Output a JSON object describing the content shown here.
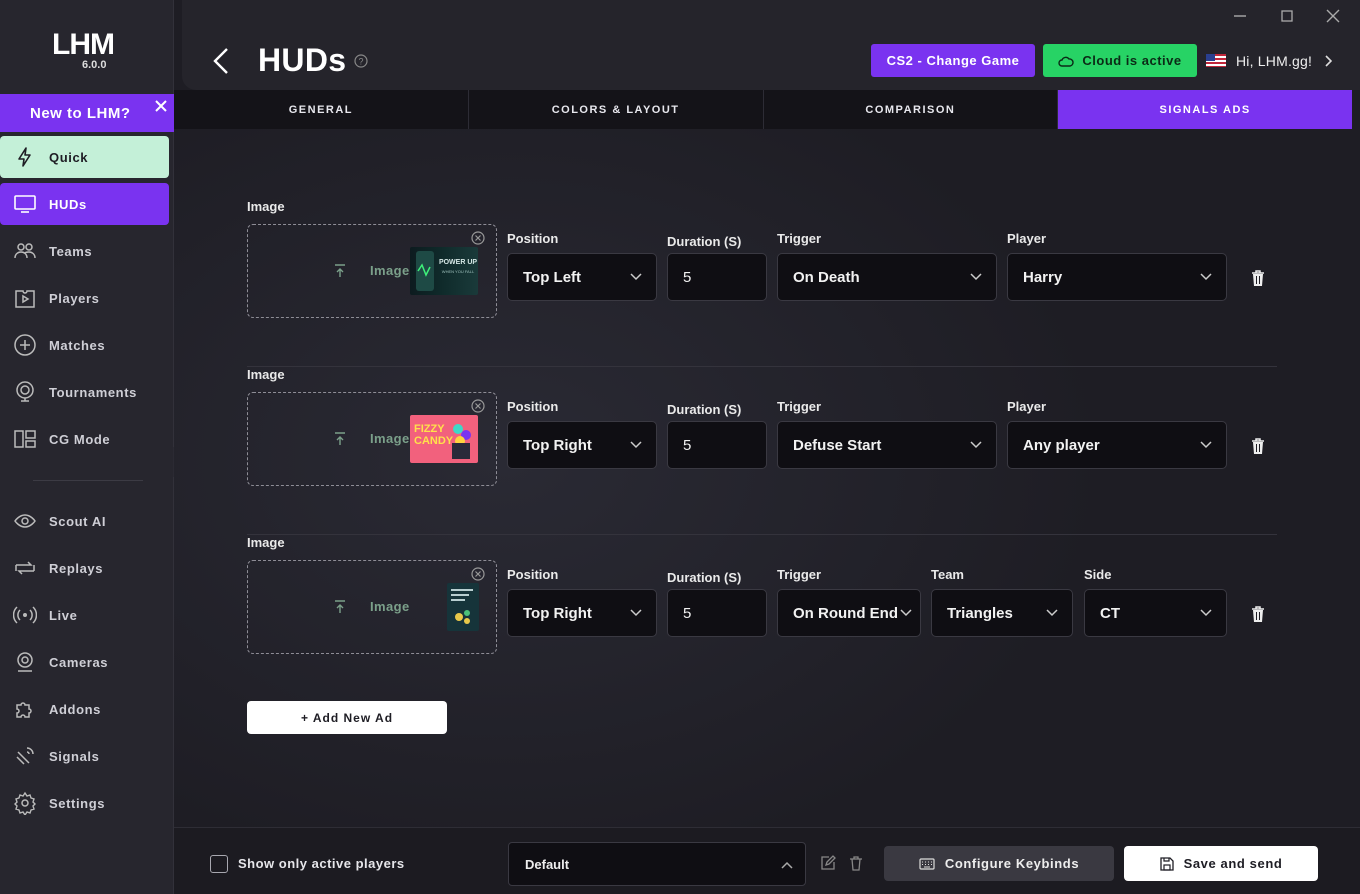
{
  "app": {
    "logo_text": "LHM",
    "version": "6.0.0"
  },
  "promo": {
    "label": "New to LHM?"
  },
  "sidebar": {
    "items": [
      {
        "label": "Quick",
        "icon": "lightning-icon"
      },
      {
        "label": "HUDs",
        "icon": "monitor-icon"
      },
      {
        "label": "Teams",
        "icon": "team-icon"
      },
      {
        "label": "Players",
        "icon": "player-icon"
      },
      {
        "label": "Matches",
        "icon": "plus-circle-icon"
      },
      {
        "label": "Tournaments",
        "icon": "trophy-icon"
      },
      {
        "label": "CG Mode",
        "icon": "layout-icon"
      },
      {
        "label": "Scout AI",
        "icon": "eye-icon"
      },
      {
        "label": "Replays",
        "icon": "replay-icon"
      },
      {
        "label": "Live",
        "icon": "broadcast-icon"
      },
      {
        "label": "Cameras",
        "icon": "camera-icon"
      },
      {
        "label": "Addons",
        "icon": "puzzle-icon"
      },
      {
        "label": "Signals",
        "icon": "satellite-icon"
      },
      {
        "label": "Settings",
        "icon": "gear-icon"
      }
    ],
    "active": "HUDs"
  },
  "header": {
    "title": "HUDs",
    "game_button": "CS2 - Change Game",
    "cloud_button": "Cloud is active",
    "user_greeting": "Hi, LHM.gg!"
  },
  "tabs": [
    {
      "label": "GENERAL"
    },
    {
      "label": "COLORS & LAYOUT"
    },
    {
      "label": "COMPARISON"
    },
    {
      "label": "SIGNALS ADS"
    }
  ],
  "active_tab": "SIGNALS ADS",
  "labels": {
    "image": "Image",
    "position": "Position",
    "duration": "Duration (S)",
    "trigger": "Trigger",
    "player": "Player",
    "team": "Team",
    "side": "Side",
    "drop_text": "Image"
  },
  "ads": [
    {
      "position": "Top Left",
      "duration": "5",
      "trigger": "On Death",
      "player": "Harry",
      "thumb_text_1": "POWER UP",
      "thumb_text_2": "WHEN YOU FALL"
    },
    {
      "position": "Top Right",
      "duration": "5",
      "trigger": "Defuse Start",
      "player": "Any player",
      "thumb_text_1": "FIZZY",
      "thumb_text_2": "CANDY"
    },
    {
      "position": "Top Right",
      "duration": "5",
      "trigger": "On Round End",
      "team": "Triangles",
      "side": "CT"
    }
  ],
  "add_button": "+ Add New Ad",
  "footer": {
    "checkbox_label": "Show only active players",
    "preset_value": "Default",
    "keybinds_button": "Configure Keybinds",
    "save_button": "Save and send"
  },
  "colors": {
    "accent": "#7a33f0",
    "cloud": "#27d365",
    "quick": "#c4f0d8",
    "background": "#1e1d24"
  }
}
